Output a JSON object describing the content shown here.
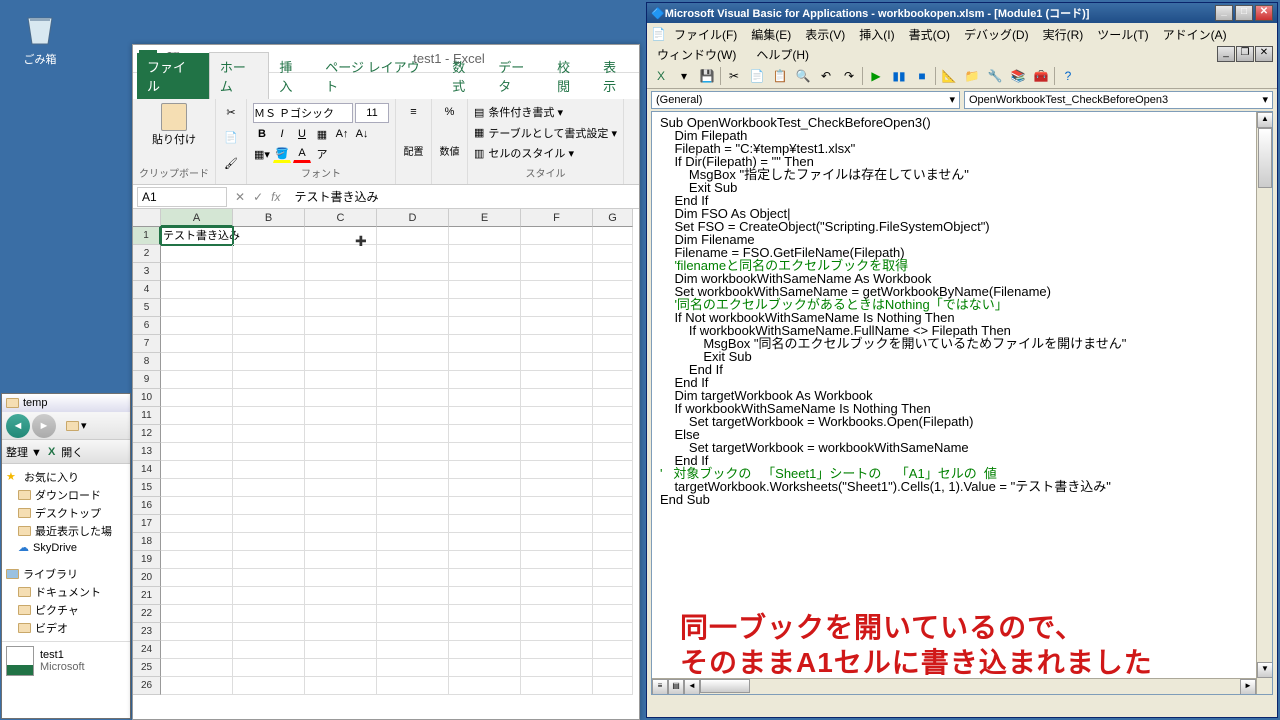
{
  "desktop": {
    "recycle_bin": "ごみ箱"
  },
  "explorer": {
    "title": "temp",
    "organize": "整理 ▼",
    "open": "開く",
    "favorites": "お気に入り",
    "downloads": "ダウンロード",
    "desktop": "デスクトップ",
    "recent": "最近表示した場",
    "skydrive": "SkyDrive",
    "library": "ライブラリ",
    "documents": "ドキュメント",
    "pictures": "ピクチャ",
    "videos": "ビデオ",
    "file_name": "test1",
    "file_type": "Microsoft"
  },
  "excel": {
    "title": "test1 - Excel",
    "tabs": {
      "file": "ファイル",
      "home": "ホーム",
      "insert": "挿入",
      "layout": "ページ レイアウト",
      "formulas": "数式",
      "data": "データ",
      "review": "校閲",
      "view": "表示"
    },
    "groups": {
      "clipboard": "クリップボード",
      "font": "フォント",
      "style": "スタイル"
    },
    "paste": "貼り付け",
    "font_name": "ＭＳ Ｐゴシック",
    "font_size": "11",
    "align": "配置",
    "number": "数値",
    "cond_fmt": "条件付き書式 ▾",
    "table_fmt": "テーブルとして書式設定 ▾",
    "cell_style": "セルのスタイル ▾",
    "namebox": "A1",
    "formula": "テスト書き込み",
    "cols": [
      "A",
      "B",
      "C",
      "D",
      "E",
      "F",
      "G"
    ],
    "a1_value": "テスト書き込み"
  },
  "vba": {
    "title": "Microsoft Visual Basic for Applications - workbookopen.xlsm - [Module1 (コード)]",
    "menus": [
      "ファイル(F)",
      "編集(E)",
      "表示(V)",
      "挿入(I)",
      "書式(O)",
      "デバッグ(D)",
      "実行(R)",
      "ツール(T)",
      "アドイン(A)"
    ],
    "menu2": [
      "ウィンドウ(W)",
      "ヘルプ(H)"
    ],
    "dd_left": "(General)",
    "dd_right": "OpenWorkbookTest_CheckBeforeOpen3",
    "code_lines": [
      {
        "t": "Sub OpenWorkbookTest_CheckBeforeOpen3()",
        "c": "p"
      },
      {
        "t": "    Dim Filepath",
        "c": "p"
      },
      {
        "t": "    Filepath = \"C:¥temp¥test1.xlsx\"",
        "c": "p"
      },
      {
        "t": "",
        "c": "p"
      },
      {
        "t": "    If Dir(Filepath) = \"\" Then",
        "c": "p"
      },
      {
        "t": "        MsgBox \"指定したファイルは存在していません\"",
        "c": "p"
      },
      {
        "t": "        Exit Sub",
        "c": "p"
      },
      {
        "t": "    End If",
        "c": "p"
      },
      {
        "t": "",
        "c": "p"
      },
      {
        "t": "    Dim FSO As Object|",
        "c": "p"
      },
      {
        "t": "    Set FSO = CreateObject(\"Scripting.FileSystemObject\")",
        "c": "p"
      },
      {
        "t": "",
        "c": "p"
      },
      {
        "t": "    Dim Filename",
        "c": "p"
      },
      {
        "t": "    Filename = FSO.GetFileName(Filepath)",
        "c": "p"
      },
      {
        "t": "",
        "c": "p"
      },
      {
        "t": "    'filenameと同名のエクセルブックを取得",
        "c": "c"
      },
      {
        "t": "    Dim workbookWithSameName As Workbook",
        "c": "p"
      },
      {
        "t": "    Set workbookWithSameName = getWorkbookByName(Filename)",
        "c": "p"
      },
      {
        "t": "",
        "c": "p"
      },
      {
        "t": "    '同名のエクセルブックがあるときはNothing「ではない」",
        "c": "c"
      },
      {
        "t": "    If Not workbookWithSameName Is Nothing Then",
        "c": "p"
      },
      {
        "t": "        If workbookWithSameName.FullName <> Filepath Then",
        "c": "p"
      },
      {
        "t": "            MsgBox \"同名のエクセルブックを開いているためファイルを開けません\"",
        "c": "p"
      },
      {
        "t": "            Exit Sub",
        "c": "p"
      },
      {
        "t": "        End If",
        "c": "p"
      },
      {
        "t": "    End If",
        "c": "p"
      },
      {
        "t": "",
        "c": "p"
      },
      {
        "t": "    Dim targetWorkbook As Workbook",
        "c": "p"
      },
      {
        "t": "",
        "c": "p"
      },
      {
        "t": "    If workbookWithSameName Is Nothing Then",
        "c": "p"
      },
      {
        "t": "        Set targetWorkbook = Workbooks.Open(Filepath)",
        "c": "p"
      },
      {
        "t": "    Else",
        "c": "p"
      },
      {
        "t": "        Set targetWorkbook = workbookWithSameName",
        "c": "p"
      },
      {
        "t": "    End If",
        "c": "p"
      },
      {
        "t": "",
        "c": "p"
      },
      {
        "t": "'   対象ブックの   「Sheet1」シートの    「A1」セルの  値",
        "c": "c"
      },
      {
        "t": "    targetWorkbook.Worksheets(\"Sheet1\").Cells(1, 1).Value = \"テスト書き込み\"",
        "c": "p"
      },
      {
        "t": "End Sub",
        "c": "p"
      }
    ],
    "annotation_l1": "同一ブックを開いているので、",
    "annotation_l2": "そのままA1セルに書き込まれました"
  }
}
